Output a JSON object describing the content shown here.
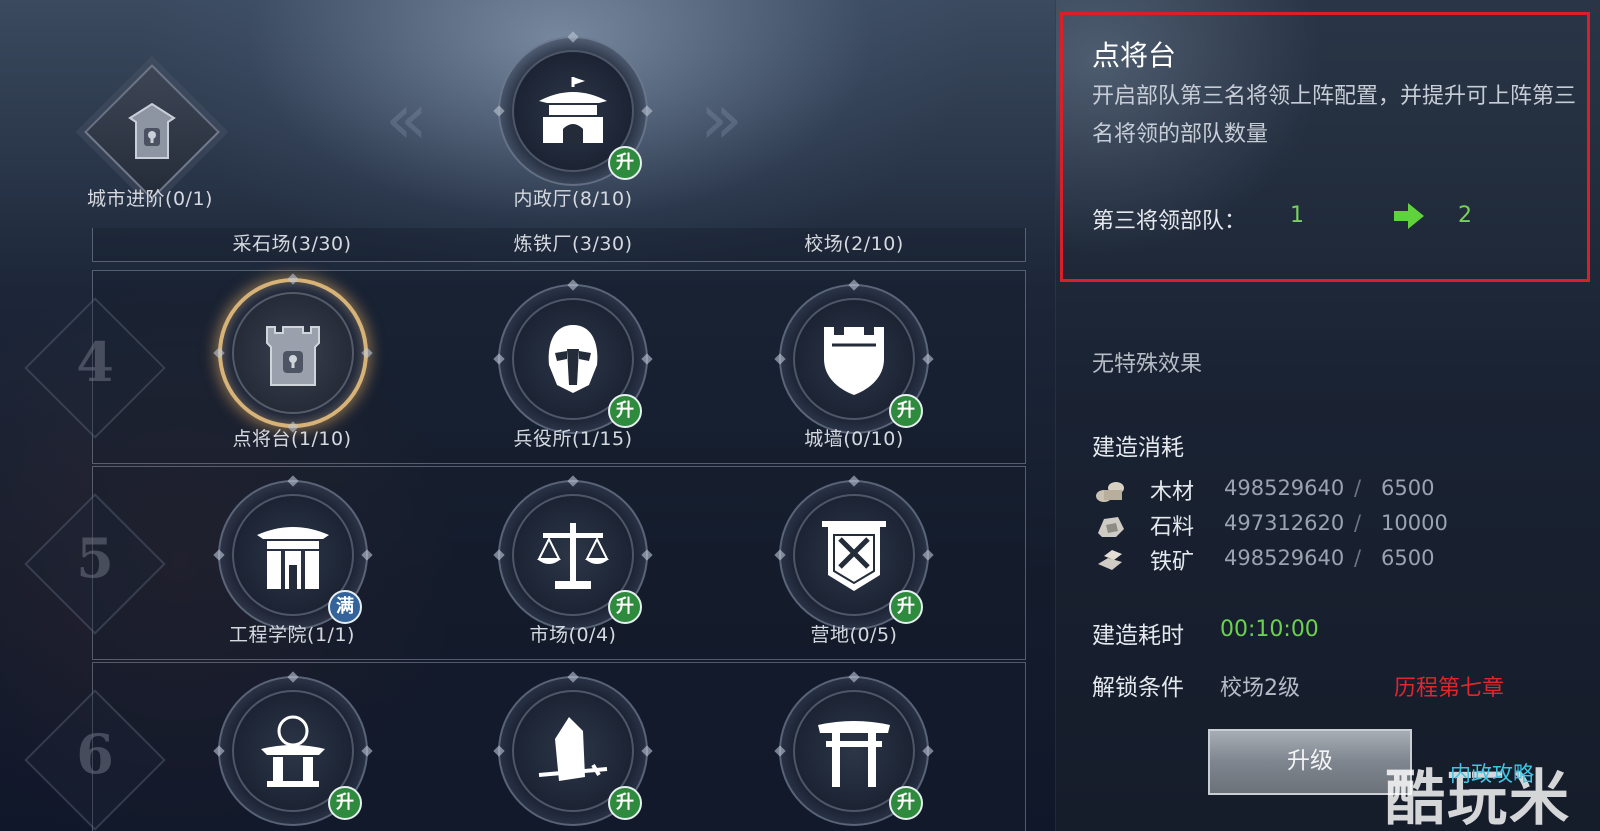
{
  "top": {
    "city_advance": {
      "label": "城市进阶(0/1)"
    },
    "interior_hall": {
      "label": "内政厅(8/10)",
      "badge": "升"
    }
  },
  "row3_labels": [
    "采石场(3/30)",
    "炼铁厂(3/30)",
    "校场(2/10)"
  ],
  "tiers": [
    {
      "number": "4",
      "buildings": [
        {
          "label": "点将台(1/10)",
          "badge": "",
          "icon": "lock-tower-icon"
        },
        {
          "label": "兵役所(1/15)",
          "badge": "升",
          "icon": "helmet-icon"
        },
        {
          "label": "城墙(0/10)",
          "badge": "升",
          "icon": "wall-shield-icon"
        }
      ]
    },
    {
      "number": "5",
      "buildings": [
        {
          "label": "工程学院(1/1)",
          "badge": "满",
          "icon": "gate-icon"
        },
        {
          "label": "市场(0/4)",
          "badge": "升",
          "icon": "scales-icon"
        },
        {
          "label": "营地(0/5)",
          "badge": "升",
          "icon": "banner-swords-icon"
        }
      ]
    },
    {
      "number": "6",
      "buildings": [
        {
          "label": "",
          "badge": "升",
          "icon": "altar-icon"
        },
        {
          "label": "",
          "badge": "升",
          "icon": "stone-sword-icon"
        },
        {
          "label": "",
          "badge": "升",
          "icon": "torii-icon"
        }
      ]
    }
  ],
  "detail": {
    "title": "点将台",
    "description": "开启部队第三名将领上阵配置，并提升可上阵第三名将领的部队数量",
    "stat_label": "第三将领部队：",
    "stat_from": "1",
    "stat_to": "2",
    "special": "无特殊效果",
    "cost_heading": "建造消耗",
    "resources": [
      {
        "name": "木材",
        "have": "498529640",
        "sep": "/",
        "need": "6500",
        "icon": "wood-icon"
      },
      {
        "name": "石料",
        "have": "497312620",
        "sep": "/",
        "need": "10000",
        "icon": "stone-icon"
      },
      {
        "name": "铁矿",
        "have": "498529640",
        "sep": "/",
        "need": "6500",
        "icon": "iron-icon"
      }
    ],
    "time_label": "建造耗时",
    "time_value": "00:10:00",
    "unlock_label": "解锁条件",
    "unlock_condition": "校场2级",
    "unlock_chapter": "历程第七章",
    "upgrade_button": "升级",
    "guide_link": "内政攻略",
    "watermark": "酷玩米"
  },
  "colors": {
    "highlight_border": "#d9202a",
    "green_value": "#78d25c",
    "red_value": "#e0262c",
    "badge_up": "#2e8a3c",
    "badge_full": "#33639a",
    "selected_ring": "#d8b378"
  }
}
